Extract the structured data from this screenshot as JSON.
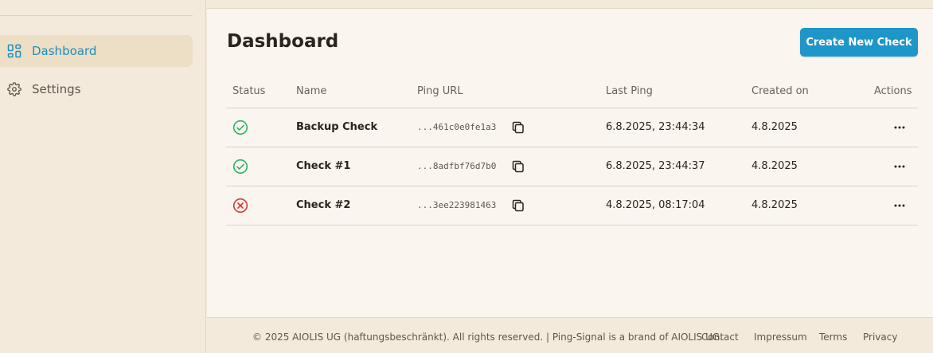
{
  "sidebar": {
    "items": [
      {
        "label": "Dashboard",
        "icon": "dashboard-icon",
        "active": true
      },
      {
        "label": "Settings",
        "icon": "gear-icon",
        "active": false
      }
    ]
  },
  "main": {
    "title": "Dashboard",
    "create_button": "Create New Check",
    "table": {
      "headers": {
        "status": "Status",
        "name": "Name",
        "ping_url": "Ping URL",
        "last_ping": "Last Ping",
        "created_on": "Created on",
        "actions": "Actions"
      },
      "rows": [
        {
          "status": "ok",
          "name": "Backup Check",
          "ping_url": "...461c0e0fe1a3",
          "last_ping": "6.8.2025, 23:44:34",
          "created_on": "4.8.2025"
        },
        {
          "status": "ok",
          "name": "Check #1",
          "ping_url": "...8adfbf76d7b0",
          "last_ping": "6.8.2025, 23:44:37",
          "created_on": "4.8.2025"
        },
        {
          "status": "fail",
          "name": "Check #2",
          "ping_url": "...3ee223981463",
          "last_ping": "4.8.2025, 08:17:04",
          "created_on": "4.8.2025"
        }
      ]
    }
  },
  "footer": {
    "copyright": "© 2025 AIOLIS UG (haftungsbeschränkt). All rights reserved. | Ping-Signal is a brand of AIOLIS UG.",
    "links": {
      "contact": "Contact",
      "impressum": "Impressum",
      "terms": "Terms",
      "privacy": "Privacy"
    }
  },
  "colors": {
    "accent": "#1f96c8",
    "status_ok": "#2fb36a",
    "status_fail": "#d63a3a",
    "background": "#f3eadc",
    "panel": "#faf6ef"
  }
}
